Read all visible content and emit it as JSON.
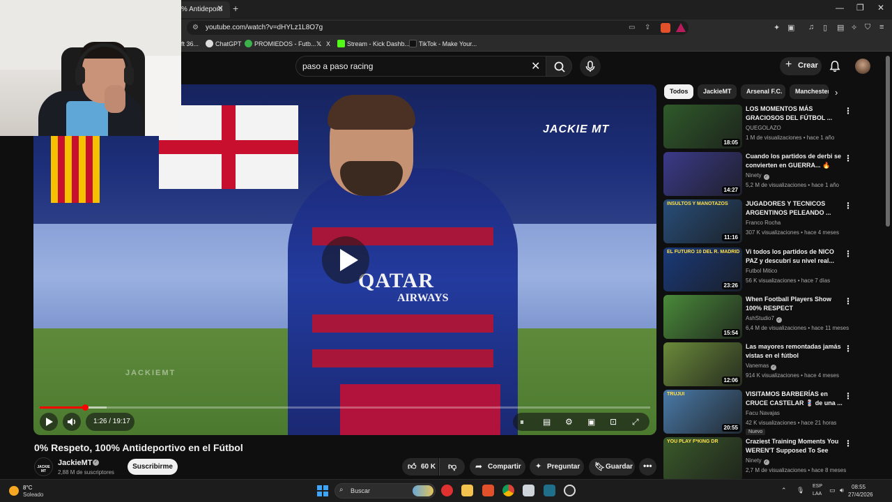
{
  "browser": {
    "tab_title": "% Antideporti",
    "url": "youtube.com/watch?v=dHYLz1L8O7g",
    "bookmarks": [
      {
        "label": "ft 36..."
      },
      {
        "label": "ChatGPT"
      },
      {
        "label": "PROMIEDOS - Futb..."
      },
      {
        "label": "X"
      },
      {
        "label": "Stream - Kick Dashb..."
      },
      {
        "label": "TikTok - Make Your..."
      }
    ]
  },
  "header": {
    "search_query": "paso a paso racing",
    "create_label": "Crear"
  },
  "player": {
    "watermark": "JACKIE MT",
    "watermark_mid": "JACKIEMT",
    "sponsor_line1": "QATAR",
    "sponsor_line2": "AIRWAYS",
    "time_display": "1:26 / 19:17",
    "progress_fraction": 0.074,
    "buffer_fraction": 0.11
  },
  "video": {
    "title": "0% Respeto, 100% Antideportivo en el Fútbol",
    "channel_name": "JackieMT",
    "channel_avatar_text": "JACKIE MT",
    "subscribers": "2,88 M de suscriptores",
    "subscribe_label": "Suscribirme",
    "likes": "60 K",
    "share_label": "Compartir",
    "ask_label": "Preguntar",
    "save_label": "Guardar"
  },
  "chips": [
    {
      "label": "Todos",
      "active": true
    },
    {
      "label": "JackieMT",
      "active": false
    },
    {
      "label": "Arsenal F.C.",
      "active": false
    },
    {
      "label": "Manchester",
      "active": false
    }
  ],
  "related": [
    {
      "title": "LOS MOMENTOS MÁS GRACIOSOS DEL FÚTBOL ...",
      "channel": "QUEGOLAZO",
      "verified": false,
      "meta": "1 M de visualizaciones • hace 1 año",
      "duration": "18:05",
      "thumb": "#2f5a2a",
      "badge": ""
    },
    {
      "title": "Cuando los partidos de derbi se convierten en GUERRA... 🔥",
      "channel": "Ninety",
      "verified": true,
      "meta": "5,2 M de visualizaciones • hace 1 año",
      "duration": "14:27",
      "thumb": "#3b3a8a",
      "badge": ""
    },
    {
      "title": "JUGADORES Y TECNICOS ARGENTINOS PELEANDO ...",
      "channel": "Franco Rocha",
      "verified": false,
      "meta": "307 K visualizaciones • hace 4 meses",
      "duration": "11:16",
      "thumb": "#284e7a",
      "badge": "",
      "overlay": "INSULTOS Y MANOTAZOS"
    },
    {
      "title": "Vi todos los partidos de NICO PAZ y descubrí su nivel real...",
      "channel": "Futbol Mitico",
      "verified": false,
      "meta": "56 K visualizaciones • hace 7 días",
      "duration": "23:26",
      "thumb": "#1a3a7a",
      "badge": "",
      "overlay": "EL FUTURO 10 DEL R. MADRID"
    },
    {
      "title": "When Football Players Show 100% RESPECT",
      "channel": "AshStudio7",
      "verified": true,
      "meta": "6,4 M de visualizaciones • hace 11 meses",
      "duration": "15:54",
      "thumb": "#4a8a3a",
      "badge": ""
    },
    {
      "title": "Las mayores remontadas jamás vistas en el fútbol",
      "channel": "Vanemas",
      "verified": true,
      "meta": "914 K visualizaciones • hace 4 meses",
      "duration": "12:06",
      "thumb": "#6a8a3a",
      "badge": ""
    },
    {
      "title": "VISITAMOS BARBERÍAS en CRUCE CASTELAR 💈 de una ...",
      "channel": "Facu Navajas",
      "verified": false,
      "meta": "42 K visualizaciones • hace 21 horas",
      "duration": "20:55",
      "thumb": "#4a7aa8",
      "badge": "Nuevo",
      "overlay": "TRUJUI"
    },
    {
      "title": "Craziest Training Moments You WEREN'T Supposed To See",
      "channel": "Ninety",
      "verified": true,
      "meta": "2,7 M de visualizaciones • hace 8 meses",
      "duration": "",
      "thumb": "#3a5a2a",
      "badge": "",
      "overlay": "YOU PLAY F*KING DR"
    }
  ],
  "taskbar": {
    "temp": "8°C",
    "weather": "Soleado",
    "search_placeholder": "Buscar",
    "lang1": "ESP",
    "lang2": "LAA",
    "time": "08:55",
    "date": "27/4/2026"
  },
  "colors": {
    "accent_red": "#ff0000",
    "bg": "#0f0f0f",
    "pill": "#272727"
  }
}
